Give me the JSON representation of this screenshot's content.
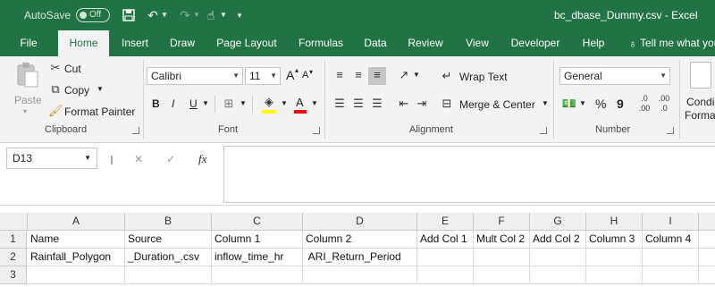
{
  "title_bar": {
    "autosave_label": "AutoSave",
    "autosave_state": "Off",
    "title": "bc_dbase_Dummy.csv  -  Excel"
  },
  "tabs": [
    "File",
    "Home",
    "Insert",
    "Draw",
    "Page Layout",
    "Formulas",
    "Data",
    "Review",
    "View",
    "Developer",
    "Help",
    "Tell me what you"
  ],
  "ribbon": {
    "clipboard": {
      "paste": "Paste",
      "cut": "Cut",
      "copy": "Copy",
      "format_painter": "Format Painter",
      "label": "Clipboard"
    },
    "font": {
      "name": "Calibri",
      "size": "11",
      "bold": "B",
      "italic": "I",
      "underline": "U",
      "grow": "A",
      "shrink": "A",
      "color": "A",
      "label": "Font"
    },
    "alignment": {
      "wrap": "Wrap Text",
      "merge": "Merge & Center",
      "label": "Alignment"
    },
    "number": {
      "format": "General",
      "percent": "%",
      "comma": "9",
      "label": "Number"
    },
    "styles": {
      "cond_line1": "Condi",
      "cond_line2": "Forma"
    }
  },
  "formula_bar": {
    "name_box": "D13",
    "fx": "fx",
    "cancel": "✕",
    "enter": "✓",
    "content": ""
  },
  "grid": {
    "columns": [
      "A",
      "B",
      "C",
      "D",
      "E",
      "F",
      "G",
      "H",
      "I"
    ],
    "rows": [
      {
        "num": "1",
        "cells": [
          "Name",
          "Source",
          "Column 1",
          "Column 2",
          "Add Col 1",
          "Mult Col 2",
          "Add Col 2",
          "Column 3",
          "Column 4"
        ]
      },
      {
        "num": "2",
        "cells": [
          "Rainfall_Polygon",
          "_Duration_.csv",
          "inflow_time_hr",
          " ARI_Return_Period",
          "",
          "",
          "",
          "",
          ""
        ]
      },
      {
        "num": "3",
        "cells": [
          "",
          "",
          "",
          "",
          "",
          "",
          "",
          "",
          ""
        ]
      }
    ]
  },
  "colors": {
    "excel_green": "#217346",
    "ribbon_bg": "#f3f3f3",
    "header_bg": "#efefef",
    "highlight_yellow": "#ffff00",
    "font_red": "#ff0000"
  }
}
